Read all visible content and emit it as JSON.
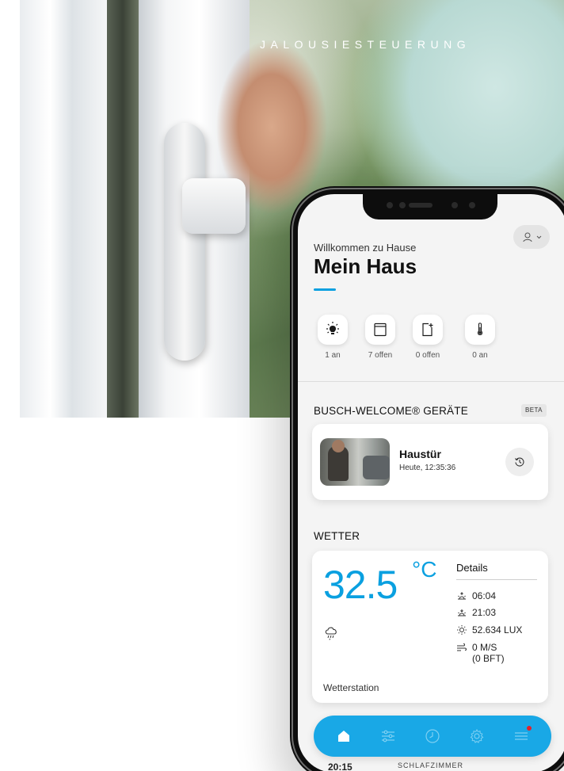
{
  "hero": {
    "title": "JALOUSIESTEUERUNG"
  },
  "app": {
    "welcome": "Willkommen zu Hause",
    "house_name": "Mein Haus",
    "accent_color": "#0aa0e0",
    "quick_status": [
      {
        "icon": "light-bulb-icon",
        "label": "1 an"
      },
      {
        "icon": "blind-icon",
        "label": "7 offen"
      },
      {
        "icon": "window-icon",
        "label": "0 offen"
      },
      {
        "icon": "thermometer-icon",
        "label": "0 an"
      }
    ],
    "welcome_section": {
      "title": "BUSCH-WELCOME® GERÄTE",
      "badge": "BETA",
      "device_name": "Haustür",
      "device_time": "Heute, 12:35:36"
    },
    "weather": {
      "title": "WETTER",
      "temperature": "32.5",
      "unit": "°C",
      "details_title": "Details",
      "sunrise": "06:04",
      "sunset": "21:03",
      "brightness": "52.634 LUX",
      "wind_ms": "0 M/S",
      "wind_bft": "(0 BFT)",
      "station": "Wetterstation"
    },
    "nav": [
      "home-icon",
      "sliders-icon",
      "clock-icon",
      "gear-icon",
      "menu-icon"
    ],
    "peek": {
      "time": "20:15",
      "label": "SCHLAFZIMMER"
    }
  }
}
